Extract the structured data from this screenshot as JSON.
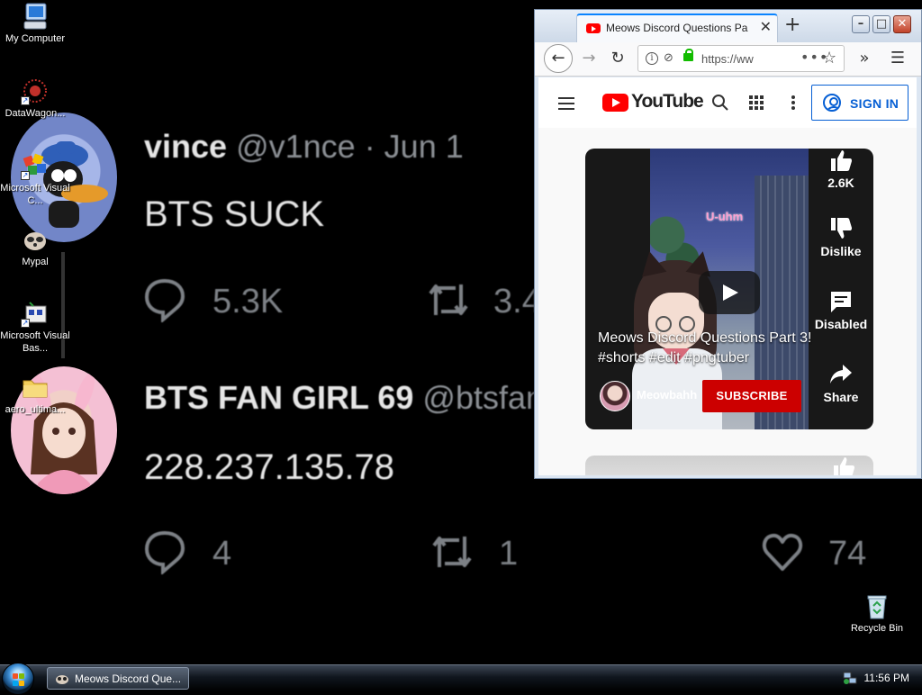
{
  "desktop": {
    "icons": [
      {
        "label": "My Computer"
      },
      {
        "label": "DataWagon..."
      },
      {
        "label": "Microsoft Visual C..."
      },
      {
        "label": "Mypal"
      },
      {
        "label": "Microsoft Visual Bas..."
      },
      {
        "label": "aero_ultima..."
      },
      {
        "label": "Recycle Bin"
      }
    ]
  },
  "wallpaper": {
    "tweet1": {
      "name": "vince",
      "handle": "@v1nce · Jun 1",
      "text": "BTS SUCK",
      "replies": "5.3K",
      "retweets": "3.4"
    },
    "tweet2": {
      "name": "BTS FAN GIRL 69",
      "handle": "@btsfan",
      "text": "228.237.135.78",
      "replies": "4",
      "retweets": "1",
      "likes": "74"
    }
  },
  "browser": {
    "tab_title": "Meows Discord Questions Part",
    "url": "https://ww",
    "colors": {
      "accent": "#0a84ff",
      "lock": "#12bc00"
    }
  },
  "youtube": {
    "logo_text": "YouTube",
    "sign_in": "SIGN IN",
    "short": {
      "overlay_text": "U-uhm",
      "title": "Meows Discord Questions Part 3! #shorts #edit #pngtuber",
      "channel": "Meowbahh",
      "subscribe": "SUBSCRIBE",
      "likes": "2.6K",
      "dislike": "Dislike",
      "comments": "Disabled",
      "share": "Share"
    },
    "colors": {
      "brand_red": "#ff0000",
      "subscribe_red": "#cc0000",
      "link_blue": "#065fd4"
    }
  },
  "taskbar": {
    "task_label": "Meows Discord Que...",
    "clock": "11:56 PM"
  }
}
